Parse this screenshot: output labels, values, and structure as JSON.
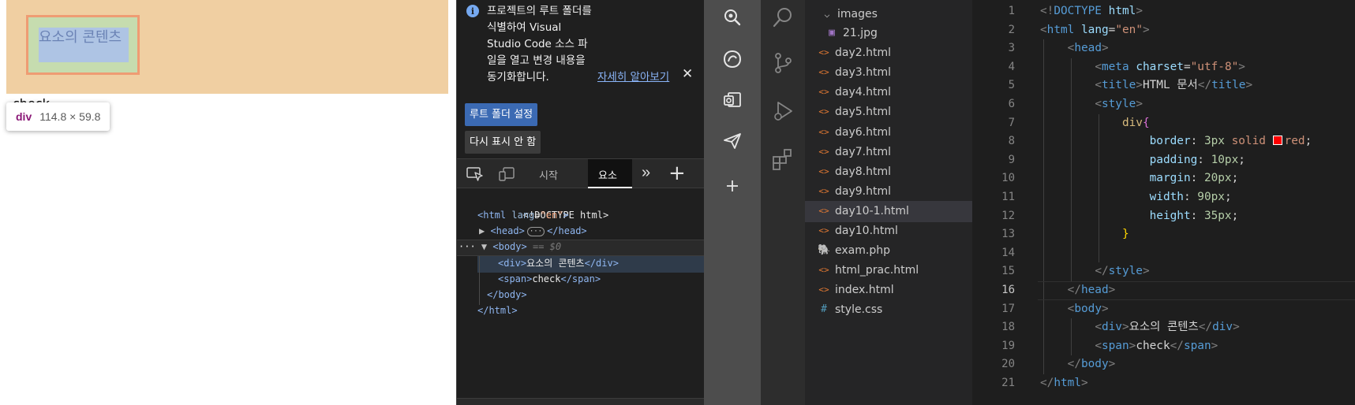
{
  "preview": {
    "div_text": "요소의 콘텐츠",
    "span_text": "check",
    "tooltip": {
      "tag": "div",
      "size": "114.8 × 59.8"
    },
    "colors": {
      "margin": "#f0cfa2",
      "border": "#ef9c73",
      "padding": "#c6dcaf",
      "content": "#aec4e4"
    }
  },
  "devtools": {
    "info": {
      "message": "프로젝트의 루트 폴더를 식별하여 Visual Studio Code 소스 파일을 열고 변경 내용을 동기화합니다.",
      "link": "자세히 알아보기",
      "close": "✕"
    },
    "buttons": {
      "set_root": "루트 폴더 설정",
      "dont_show": "다시 표시 안 함"
    },
    "tabs": {
      "start": "시작",
      "elements": "요소",
      "more": "»",
      "add": "+"
    },
    "dom": {
      "doctype": "<!DOCTYPE html>",
      "html_open_tag": "html",
      "html_attr": "lang",
      "html_attr_value": "\"en\"",
      "head": "<head>",
      "head_close": "</head>",
      "ellipsis": "···",
      "body": "<body>",
      "body_marker": "== $0",
      "row_dots": "···",
      "div_open": "<div>",
      "div_text": "요소의 콘텐츠",
      "div_close": "</div>",
      "span_open": "<span>",
      "span_text": "check",
      "span_close": "</span>",
      "body_close": "</body>",
      "html_close": "</html>"
    }
  },
  "explorer": {
    "folder": "images",
    "files": [
      {
        "name": "21.jpg",
        "type": "image",
        "indent": 2
      },
      {
        "name": "day2.html",
        "type": "html",
        "indent": 1
      },
      {
        "name": "day3.html",
        "type": "html",
        "indent": 1
      },
      {
        "name": "day4.html",
        "type": "html",
        "indent": 1
      },
      {
        "name": "day5.html",
        "type": "html",
        "indent": 1
      },
      {
        "name": "day6.html",
        "type": "html",
        "indent": 1
      },
      {
        "name": "day7.html",
        "type": "html",
        "indent": 1
      },
      {
        "name": "day8.html",
        "type": "html",
        "indent": 1
      },
      {
        "name": "day9.html",
        "type": "html",
        "indent": 1
      },
      {
        "name": "day10-1.html",
        "type": "html",
        "indent": 1,
        "active": true
      },
      {
        "name": "day10.html",
        "type": "html",
        "indent": 1
      },
      {
        "name": "exam.php",
        "type": "php",
        "indent": 1
      },
      {
        "name": "html_prac.html",
        "type": "html",
        "indent": 1
      },
      {
        "name": "index.html",
        "type": "html",
        "indent": 1
      },
      {
        "name": "style.css",
        "type": "css",
        "indent": 1
      }
    ]
  },
  "editor": {
    "current_line": 16,
    "lines": [
      [
        [
          "c-punc",
          "<!"
        ],
        [
          "c-tag",
          "DOCTYPE"
        ],
        [
          "c-txt",
          " "
        ],
        [
          "c-attr",
          "html"
        ],
        [
          "c-punc",
          ">"
        ]
      ],
      [
        [
          "c-punc",
          "<"
        ],
        [
          "c-tag",
          "html"
        ],
        [
          "c-txt",
          " "
        ],
        [
          "c-attr",
          "lang"
        ],
        [
          "c-txt",
          "="
        ],
        [
          "c-str",
          "\"en\""
        ],
        [
          "c-punc",
          ">"
        ]
      ],
      [
        [
          "c-txt",
          "    "
        ],
        [
          "c-punc",
          "<"
        ],
        [
          "c-tag",
          "head"
        ],
        [
          "c-punc",
          ">"
        ]
      ],
      [
        [
          "c-txt",
          "        "
        ],
        [
          "c-punc",
          "<"
        ],
        [
          "c-tag",
          "meta"
        ],
        [
          "c-txt",
          " "
        ],
        [
          "c-attr",
          "charset"
        ],
        [
          "c-txt",
          "="
        ],
        [
          "c-str",
          "\"utf-8\""
        ],
        [
          "c-punc",
          ">"
        ]
      ],
      [
        [
          "c-txt",
          "        "
        ],
        [
          "c-punc",
          "<"
        ],
        [
          "c-tag",
          "title"
        ],
        [
          "c-punc",
          ">"
        ],
        [
          "c-txt",
          "HTML 문서"
        ],
        [
          "c-punc",
          "</"
        ],
        [
          "c-tag",
          "title"
        ],
        [
          "c-punc",
          ">"
        ]
      ],
      [
        [
          "c-txt",
          "        "
        ],
        [
          "c-punc",
          "<"
        ],
        [
          "c-tag",
          "style"
        ],
        [
          "c-punc",
          ">"
        ]
      ],
      [
        [
          "c-txt",
          "            "
        ],
        [
          "c-sel",
          "div"
        ],
        [
          "c-brace1",
          "{"
        ]
      ],
      [
        [
          "c-txt",
          "                "
        ],
        [
          "c-attr",
          "border"
        ],
        [
          "c-txt",
          ": "
        ],
        [
          "c-num",
          "3px"
        ],
        [
          "c-txt",
          " "
        ],
        [
          "c-str",
          "solid"
        ],
        [
          "c-txt",
          " "
        ],
        [
          "swatch",
          ""
        ],
        [
          "c-str",
          "red"
        ],
        [
          "c-txt",
          ";"
        ]
      ],
      [
        [
          "c-txt",
          "                "
        ],
        [
          "c-attr",
          "padding"
        ],
        [
          "c-txt",
          ": "
        ],
        [
          "c-num",
          "10px"
        ],
        [
          "c-txt",
          ";"
        ]
      ],
      [
        [
          "c-txt",
          "                "
        ],
        [
          "c-attr",
          "margin"
        ],
        [
          "c-txt",
          ": "
        ],
        [
          "c-num",
          "20px"
        ],
        [
          "c-txt",
          ";"
        ]
      ],
      [
        [
          "c-txt",
          "                "
        ],
        [
          "c-attr",
          "width"
        ],
        [
          "c-txt",
          ": "
        ],
        [
          "c-num",
          "90px"
        ],
        [
          "c-txt",
          ";"
        ]
      ],
      [
        [
          "c-txt",
          "                "
        ],
        [
          "c-attr",
          "height"
        ],
        [
          "c-txt",
          ": "
        ],
        [
          "c-num",
          "35px"
        ],
        [
          "c-txt",
          ";"
        ]
      ],
      [
        [
          "c-txt",
          "            "
        ],
        [
          "c-brace2",
          "}"
        ]
      ],
      [
        [
          "c-txt",
          ""
        ]
      ],
      [
        [
          "c-txt",
          "        "
        ],
        [
          "c-punc",
          "</"
        ],
        [
          "c-tag",
          "style"
        ],
        [
          "c-punc",
          ">"
        ]
      ],
      [
        [
          "c-txt",
          "    "
        ],
        [
          "c-punc",
          "</"
        ],
        [
          "c-tag",
          "head"
        ],
        [
          "c-punc",
          ">"
        ]
      ],
      [
        [
          "c-txt",
          "    "
        ],
        [
          "c-punc",
          "<"
        ],
        [
          "c-tag",
          "body"
        ],
        [
          "c-punc",
          ">"
        ]
      ],
      [
        [
          "c-txt",
          "        "
        ],
        [
          "c-punc",
          "<"
        ],
        [
          "c-tag",
          "div"
        ],
        [
          "c-punc",
          ">"
        ],
        [
          "c-txt",
          "요소의 콘텐츠"
        ],
        [
          "c-punc",
          "</"
        ],
        [
          "c-tag",
          "div"
        ],
        [
          "c-punc",
          ">"
        ]
      ],
      [
        [
          "c-txt",
          "        "
        ],
        [
          "c-punc",
          "<"
        ],
        [
          "c-tag",
          "span"
        ],
        [
          "c-punc",
          ">"
        ],
        [
          "c-txt",
          "check"
        ],
        [
          "c-punc",
          "</"
        ],
        [
          "c-tag",
          "span"
        ],
        [
          "c-punc",
          ">"
        ]
      ],
      [
        [
          "c-txt",
          "    "
        ],
        [
          "c-punc",
          "</"
        ],
        [
          "c-tag",
          "body"
        ],
        [
          "c-punc",
          ">"
        ]
      ],
      [
        [
          "c-punc",
          "</"
        ],
        [
          "c-tag",
          "html"
        ],
        [
          "c-punc",
          ">"
        ]
      ]
    ]
  }
}
